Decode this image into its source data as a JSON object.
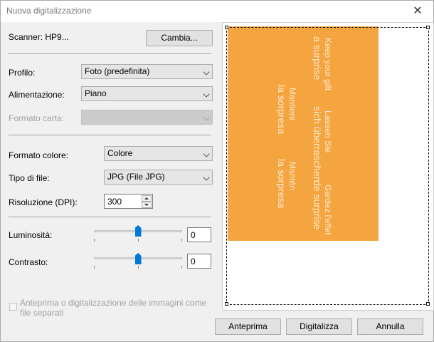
{
  "window": {
    "title": "Nuova digitalizzazione",
    "close_glyph": "✕"
  },
  "scanner": {
    "label": "Scanner: HP9...",
    "change_button": "Cambia..."
  },
  "profile": {
    "label": "Profilo:",
    "value": "Foto (predefinita)"
  },
  "feed": {
    "label": "Alimentazione:",
    "value": "Piano"
  },
  "paper_size": {
    "label": "Formato carta:",
    "value": ""
  },
  "color_format": {
    "label": "Formato colore:",
    "value": "Colore"
  },
  "file_type": {
    "label": "Tipo di file:",
    "value": "JPG (File JPG)"
  },
  "resolution": {
    "label": "Risoluzione (DPI):",
    "value": "300"
  },
  "brightness": {
    "label": "Luminosità:",
    "value": "0",
    "level": 0.5
  },
  "contrast": {
    "label": "Contrasto:",
    "value": "0",
    "level": 0.5
  },
  "separate_files": {
    "label_line1": "Anteprima o digitalizzazione delle immagini come",
    "label_line2": "file separati",
    "checked": false
  },
  "buttons": {
    "preview": "Anteprima",
    "scan": "Digitalizza",
    "cancel": "Annulla"
  },
  "preview_image": {
    "envelope_color": "#f5a53f",
    "lines": [
      "Keep your gift",
      "a surprise",
      "Lassen Sie",
      "sich überraschen",
      "Gardez l'effet",
      "de surprise",
      "Mantieni",
      "la sorpresa",
      "Mantén",
      "la sorpresa"
    ]
  }
}
